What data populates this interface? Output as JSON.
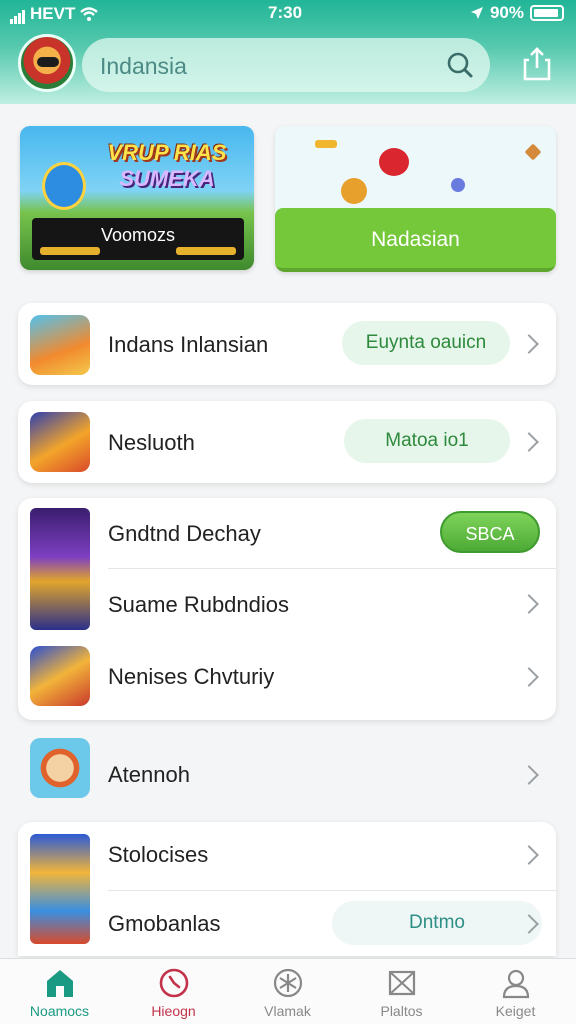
{
  "status_bar": {
    "carrier": "HEVT",
    "time": "7:30",
    "battery": "90%"
  },
  "header": {
    "search_placeholder": "Indansia"
  },
  "banners": {
    "left_title_line1": "VRUP RIAS",
    "left_title_line2": "SUMEKA",
    "left_label": "Voomozs",
    "right_button": "Nadasian"
  },
  "list": {
    "item1": {
      "title": "Indans Inlansian",
      "pill": "Euynta oauicn"
    },
    "item2": {
      "title": "Nesluoth",
      "pill": "Matoa io1"
    },
    "group3": {
      "row1": {
        "title": "Gndtnd Dechay",
        "button": "SBCA"
      },
      "row2": {
        "title": "Suame Rubdndios"
      },
      "row3": {
        "title": "Nenises Chvturiy"
      }
    },
    "item4": {
      "title": "Atennoh"
    },
    "group5": {
      "row1": {
        "title": "Stolocises"
      },
      "row2": {
        "title": "Gmobanlas",
        "pill": "Dntmo"
      }
    }
  },
  "tabs": [
    {
      "label": "Noamocs",
      "icon": "home-icon",
      "color": "#1a9a82"
    },
    {
      "label": "Hieogn",
      "icon": "clock-icon",
      "color": "#c2334b"
    },
    {
      "label": "Vlamak",
      "icon": "asterisk-icon",
      "color": "#888888"
    },
    {
      "label": "Plaltos",
      "icon": "mail-icon",
      "color": "#888888"
    },
    {
      "label": "Keiget",
      "icon": "user-icon",
      "color": "#888888"
    }
  ],
  "colors": {
    "header_teal": "#21b597",
    "accent_green": "#75c83a",
    "pill_bg": "#e6f6ea"
  }
}
